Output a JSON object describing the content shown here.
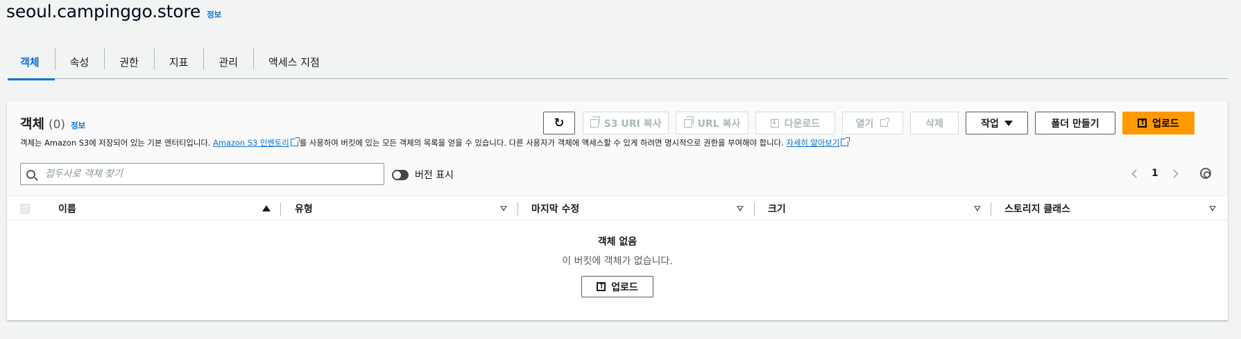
{
  "header": {
    "bucket_name": "seoul.campinggo.store",
    "info": "정보"
  },
  "tabs": [
    {
      "label": "객체"
    },
    {
      "label": "속성"
    },
    {
      "label": "권한"
    },
    {
      "label": "지표"
    },
    {
      "label": "관리"
    },
    {
      "label": "액세스 지점"
    }
  ],
  "objects": {
    "title": "객체",
    "count": "(0)",
    "info": "정보",
    "desc_prefix": "객체는 Amazon S3에 저장되어 있는 기본 엔터티입니다. ",
    "desc_link1": "Amazon S3 인벤토리",
    "desc_middle": "를 사용하여 버킷에 있는 모든 객체의 목록을 얻을 수 있습니다. 다른 사용자가 객체에 액세스할 수 있게 하려면 명시적으로 권한을 부여해야 합니다. ",
    "desc_link2": "자세히 알아보기"
  },
  "toolbar": {
    "copy_s3_uri": "S3 URI 복사",
    "copy_url": "URL 복사",
    "download": "다운로드",
    "open": "열기",
    "delete": "삭제",
    "actions": "작업",
    "create_folder": "폴더 만들기",
    "upload": "업로드"
  },
  "search": {
    "placeholder": "접두사로 객체 찾기"
  },
  "version_toggle": "버전 표시",
  "pagination": {
    "page": "1"
  },
  "table": {
    "columns": [
      "이름",
      "유형",
      "마지막 수정",
      "크기",
      "스토리지 클래스"
    ]
  },
  "empty": {
    "title": "객체 없음",
    "message": "이 버킷에 객체가 없습니다.",
    "upload": "업로드"
  },
  "colors": {
    "accent": "#0972d3",
    "primary_button": "#ff9900"
  }
}
